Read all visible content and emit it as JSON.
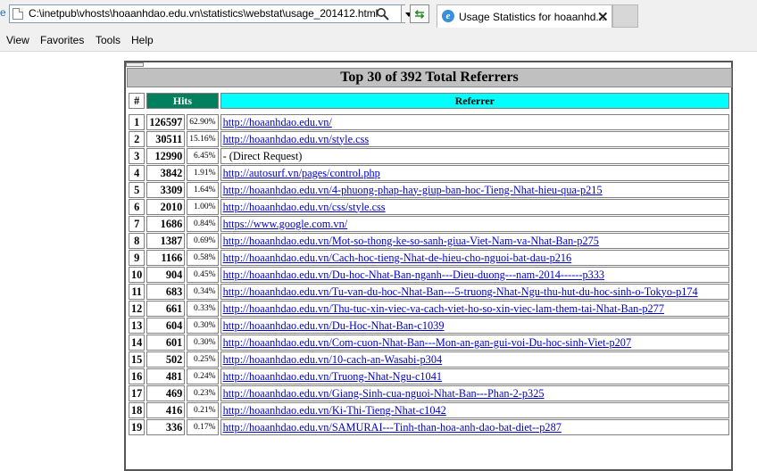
{
  "browser": {
    "address": "C:\\inetpub\\vhosts\\hoaanhdao.edu.vn\\statistics\\webstat\\usage_201412.html",
    "tab_title": "Usage Statistics for hoaanhd...",
    "menu": [
      "View",
      "Favorites",
      "Tools",
      "Help"
    ]
  },
  "report": {
    "title": "Top 30 of 392 Total Referrers",
    "col_num": "#",
    "col_hits": "Hits",
    "col_referrer": "Referrer",
    "rows": [
      {
        "n": "1",
        "hits": "126597",
        "pct": "62.90%",
        "ref": "http://hoaanhdao.edu.vn/",
        "link": true
      },
      {
        "n": "2",
        "hits": "30511",
        "pct": "15.16%",
        "ref": "http://hoaanhdao.edu.vn/style.css",
        "link": true
      },
      {
        "n": "3",
        "hits": "12990",
        "pct": "6.45%",
        "ref": "- (Direct Request)",
        "link": false
      },
      {
        "n": "4",
        "hits": "3842",
        "pct": "1.91%",
        "ref": "http://autosurf.vn/pages/control.php",
        "link": true
      },
      {
        "n": "5",
        "hits": "3309",
        "pct": "1.64%",
        "ref": "http://hoaanhdao.edu.vn/4-phuong-phap-hay-giup-ban-hoc-Tieng-Nhat-hieu-qua-p215",
        "link": true
      },
      {
        "n": "6",
        "hits": "2010",
        "pct": "1.00%",
        "ref": "http://hoaanhdao.edu.vn/css/style.css",
        "link": true
      },
      {
        "n": "7",
        "hits": "1686",
        "pct": "0.84%",
        "ref": "https://www.google.com.vn/",
        "link": true
      },
      {
        "n": "8",
        "hits": "1387",
        "pct": "0.69%",
        "ref": "http://hoaanhdao.edu.vn/Mot-so-thong-ke-so-sanh-giua-Viet-Nam-va-Nhat-Ban-p275",
        "link": true
      },
      {
        "n": "9",
        "hits": "1166",
        "pct": "0.58%",
        "ref": "http://hoaanhdao.edu.vn/Cach-hoc-tieng-Nhat-de-hieu-cho-nguoi-bat-dau-p216",
        "link": true
      },
      {
        "n": "10",
        "hits": "904",
        "pct": "0.45%",
        "ref": "http://hoaanhdao.edu.vn/Du-hoc-Nhat-Ban-nganh---Dieu-duong---nam-2014------p333",
        "link": true
      },
      {
        "n": "11",
        "hits": "683",
        "pct": "0.34%",
        "ref": "http://hoaanhdao.edu.vn/Tu-van-du-hoc-Nhat-Ban---5-truong-Nhat-Ngu-thu-hut-du-hoc-sinh-o-Tokyo-p174",
        "link": true
      },
      {
        "n": "12",
        "hits": "661",
        "pct": "0.33%",
        "ref": "http://hoaanhdao.edu.vn/Thu-tuc-xin-viec-va-cach-viet-ho-so-xin-viec-lam-them-tai-Nhat-Ban-p277",
        "link": true
      },
      {
        "n": "13",
        "hits": "604",
        "pct": "0.30%",
        "ref": "http://hoaanhdao.edu.vn/Du-Hoc-Nhat-Ban-c1039",
        "link": true
      },
      {
        "n": "14",
        "hits": "601",
        "pct": "0.30%",
        "ref": "http://hoaanhdao.edu.vn/Com-cuon-Nhat-Ban---Mon-an-gan-gui-voi-Du-hoc-sinh-Viet-p207",
        "link": true
      },
      {
        "n": "15",
        "hits": "502",
        "pct": "0.25%",
        "ref": "http://hoaanhdao.edu.vn/10-cach-an-Wasabi-p304",
        "link": true
      },
      {
        "n": "16",
        "hits": "481",
        "pct": "0.24%",
        "ref": "http://hoaanhdao.edu.vn/Truong-Nhat-Ngu-c1041",
        "link": true
      },
      {
        "n": "17",
        "hits": "469",
        "pct": "0.23%",
        "ref": "http://hoaanhdao.edu.vn/Giang-Sinh-cua-nguoi-Nhat-Ban---Phan-2-p325",
        "link": true
      },
      {
        "n": "18",
        "hits": "416",
        "pct": "0.21%",
        "ref": "http://hoaanhdao.edu.vn/Ki-Thi-Tieng-Nhat-c1042",
        "link": true
      },
      {
        "n": "19",
        "hits": "336",
        "pct": "0.17%",
        "ref": "http://hoaanhdao.edu.vn/SAMURAI---Tinh-than-hoa-anh-dao-bat-diet--p287",
        "link": true
      }
    ]
  }
}
